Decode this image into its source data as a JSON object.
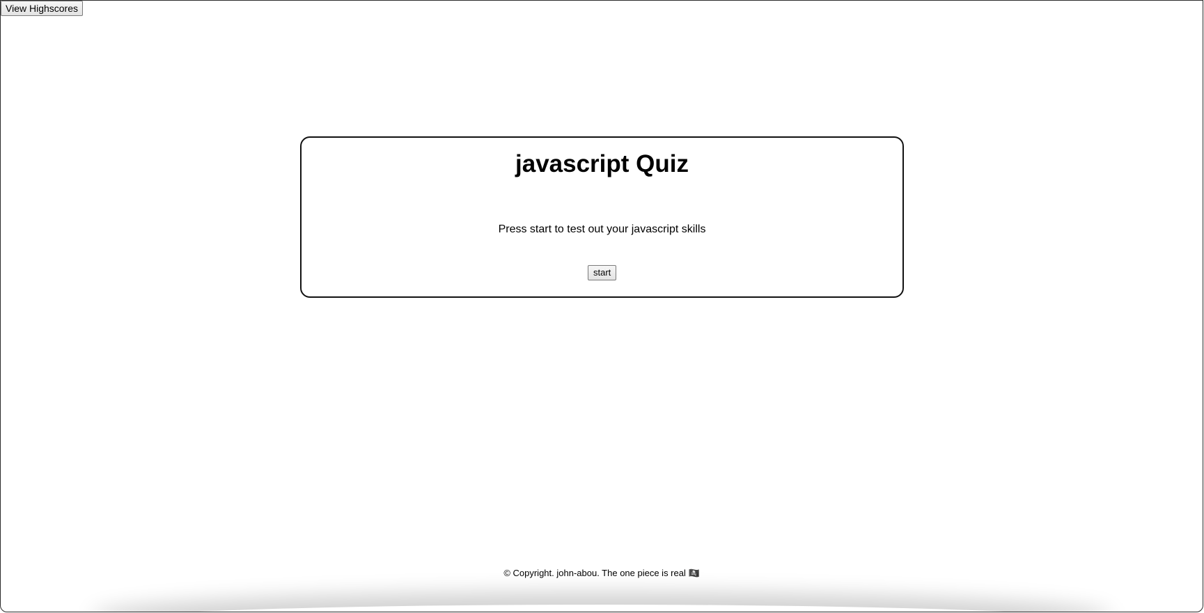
{
  "header": {
    "highscores_label": "View Highscores"
  },
  "quiz": {
    "title": "javascript Quiz",
    "description": "Press start to test out your javascript skills",
    "start_label": "start"
  },
  "footer": {
    "text": "© Copyright. john-abou. The one piece is real 🏴‍☠️"
  }
}
